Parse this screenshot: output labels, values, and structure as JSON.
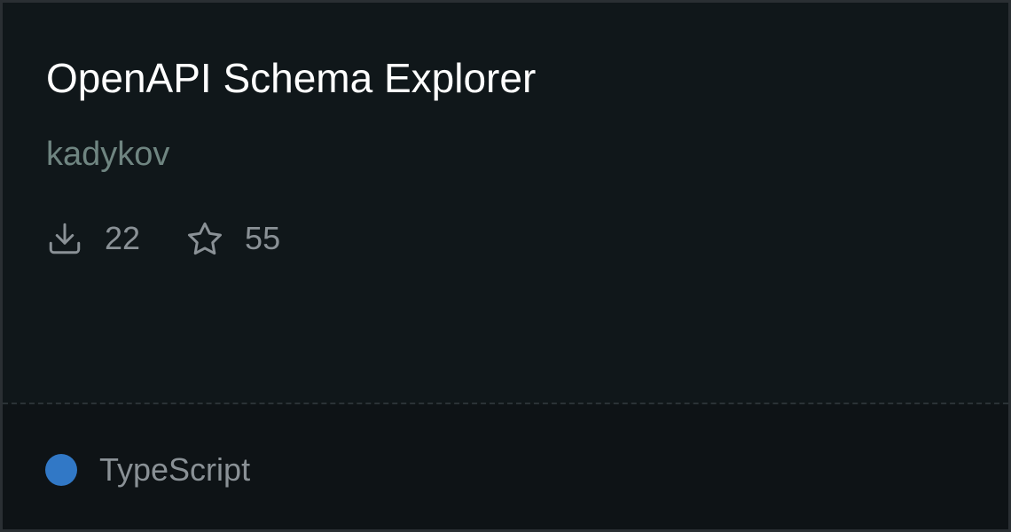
{
  "package": {
    "title": "OpenAPI Schema Explorer",
    "author": "kadykov",
    "stats": {
      "downloads": {
        "icon": "download-icon",
        "value": "22"
      },
      "stars": {
        "icon": "star-icon",
        "value": "55"
      }
    },
    "language": {
      "name": "TypeScript",
      "color": "#3178c6"
    }
  },
  "colors": {
    "title": "#ffffff",
    "author": "#6f8581",
    "muted": "#8a9196",
    "background": "#10171a",
    "footer_background": "#0e1316"
  }
}
